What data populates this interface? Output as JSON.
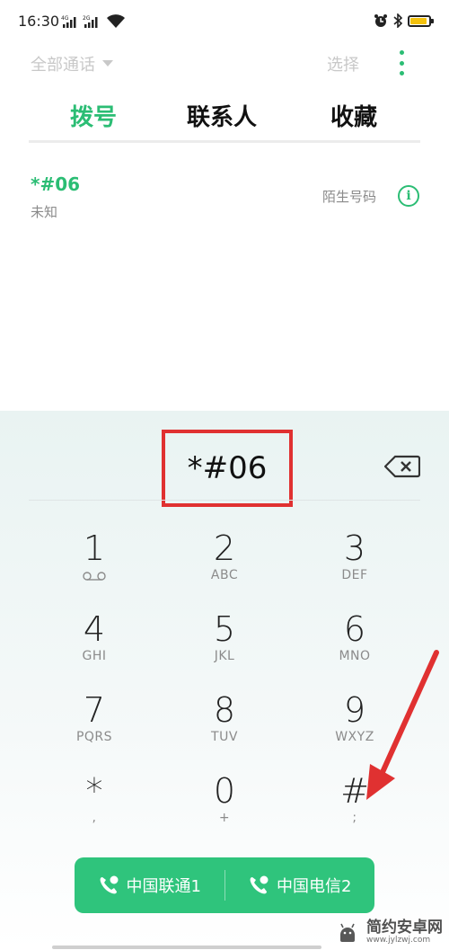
{
  "status": {
    "time": "16:30",
    "sim1_label": "4G",
    "sim2_label": "2G"
  },
  "topbar": {
    "filter_label": "全部通话",
    "select_label": "选择"
  },
  "tabs": [
    {
      "label": "拨号",
      "active": true
    },
    {
      "label": "联系人",
      "active": false
    },
    {
      "label": "收藏",
      "active": false
    }
  ],
  "call_log": [
    {
      "number": "*#06",
      "location": "未知",
      "tag": "陌生号码"
    }
  ],
  "dialer": {
    "input_value": "*#06",
    "keys": [
      {
        "digit": "1",
        "sub": ""
      },
      {
        "digit": "2",
        "sub": "ABC"
      },
      {
        "digit": "3",
        "sub": "DEF"
      },
      {
        "digit": "4",
        "sub": "GHI"
      },
      {
        "digit": "5",
        "sub": "JKL"
      },
      {
        "digit": "6",
        "sub": "MNO"
      },
      {
        "digit": "7",
        "sub": "PQRS"
      },
      {
        "digit": "8",
        "sub": "TUV"
      },
      {
        "digit": "9",
        "sub": "WXYZ"
      },
      {
        "digit": "*",
        "sub": ","
      },
      {
        "digit": "0",
        "sub": "+"
      },
      {
        "digit": "#",
        "sub": ";"
      }
    ]
  },
  "call_buttons": [
    {
      "label": "中国联通1",
      "sim": "1"
    },
    {
      "label": "中国电信2",
      "sim": "2"
    }
  ],
  "watermark": {
    "title": "简约安卓网",
    "url": "www.jylzwj.com"
  },
  "colors": {
    "accent": "#2bbd74",
    "callbar": "#2fc47c",
    "highlight_box": "#e03131",
    "annotation_arrow": "#e03131"
  }
}
